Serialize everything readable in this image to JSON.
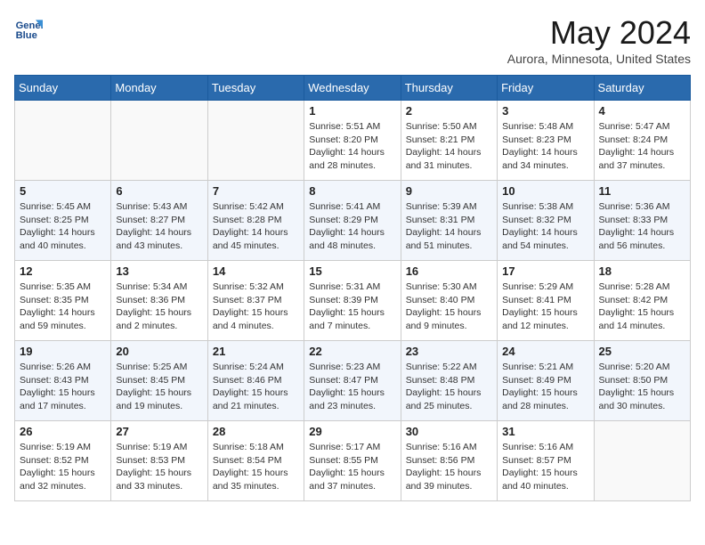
{
  "header": {
    "logo_line1": "General",
    "logo_line2": "Blue",
    "month_title": "May 2024",
    "location": "Aurora, Minnesota, United States"
  },
  "weekdays": [
    "Sunday",
    "Monday",
    "Tuesday",
    "Wednesday",
    "Thursday",
    "Friday",
    "Saturday"
  ],
  "weeks": [
    {
      "days": [
        {
          "num": "",
          "info": ""
        },
        {
          "num": "",
          "info": ""
        },
        {
          "num": "",
          "info": ""
        },
        {
          "num": "1",
          "info": "Sunrise: 5:51 AM\nSunset: 8:20 PM\nDaylight: 14 hours\nand 28 minutes."
        },
        {
          "num": "2",
          "info": "Sunrise: 5:50 AM\nSunset: 8:21 PM\nDaylight: 14 hours\nand 31 minutes."
        },
        {
          "num": "3",
          "info": "Sunrise: 5:48 AM\nSunset: 8:23 PM\nDaylight: 14 hours\nand 34 minutes."
        },
        {
          "num": "4",
          "info": "Sunrise: 5:47 AM\nSunset: 8:24 PM\nDaylight: 14 hours\nand 37 minutes."
        }
      ]
    },
    {
      "days": [
        {
          "num": "5",
          "info": "Sunrise: 5:45 AM\nSunset: 8:25 PM\nDaylight: 14 hours\nand 40 minutes."
        },
        {
          "num": "6",
          "info": "Sunrise: 5:43 AM\nSunset: 8:27 PM\nDaylight: 14 hours\nand 43 minutes."
        },
        {
          "num": "7",
          "info": "Sunrise: 5:42 AM\nSunset: 8:28 PM\nDaylight: 14 hours\nand 45 minutes."
        },
        {
          "num": "8",
          "info": "Sunrise: 5:41 AM\nSunset: 8:29 PM\nDaylight: 14 hours\nand 48 minutes."
        },
        {
          "num": "9",
          "info": "Sunrise: 5:39 AM\nSunset: 8:31 PM\nDaylight: 14 hours\nand 51 minutes."
        },
        {
          "num": "10",
          "info": "Sunrise: 5:38 AM\nSunset: 8:32 PM\nDaylight: 14 hours\nand 54 minutes."
        },
        {
          "num": "11",
          "info": "Sunrise: 5:36 AM\nSunset: 8:33 PM\nDaylight: 14 hours\nand 56 minutes."
        }
      ]
    },
    {
      "days": [
        {
          "num": "12",
          "info": "Sunrise: 5:35 AM\nSunset: 8:35 PM\nDaylight: 14 hours\nand 59 minutes."
        },
        {
          "num": "13",
          "info": "Sunrise: 5:34 AM\nSunset: 8:36 PM\nDaylight: 15 hours\nand 2 minutes."
        },
        {
          "num": "14",
          "info": "Sunrise: 5:32 AM\nSunset: 8:37 PM\nDaylight: 15 hours\nand 4 minutes."
        },
        {
          "num": "15",
          "info": "Sunrise: 5:31 AM\nSunset: 8:39 PM\nDaylight: 15 hours\nand 7 minutes."
        },
        {
          "num": "16",
          "info": "Sunrise: 5:30 AM\nSunset: 8:40 PM\nDaylight: 15 hours\nand 9 minutes."
        },
        {
          "num": "17",
          "info": "Sunrise: 5:29 AM\nSunset: 8:41 PM\nDaylight: 15 hours\nand 12 minutes."
        },
        {
          "num": "18",
          "info": "Sunrise: 5:28 AM\nSunset: 8:42 PM\nDaylight: 15 hours\nand 14 minutes."
        }
      ]
    },
    {
      "days": [
        {
          "num": "19",
          "info": "Sunrise: 5:26 AM\nSunset: 8:43 PM\nDaylight: 15 hours\nand 17 minutes."
        },
        {
          "num": "20",
          "info": "Sunrise: 5:25 AM\nSunset: 8:45 PM\nDaylight: 15 hours\nand 19 minutes."
        },
        {
          "num": "21",
          "info": "Sunrise: 5:24 AM\nSunset: 8:46 PM\nDaylight: 15 hours\nand 21 minutes."
        },
        {
          "num": "22",
          "info": "Sunrise: 5:23 AM\nSunset: 8:47 PM\nDaylight: 15 hours\nand 23 minutes."
        },
        {
          "num": "23",
          "info": "Sunrise: 5:22 AM\nSunset: 8:48 PM\nDaylight: 15 hours\nand 25 minutes."
        },
        {
          "num": "24",
          "info": "Sunrise: 5:21 AM\nSunset: 8:49 PM\nDaylight: 15 hours\nand 28 minutes."
        },
        {
          "num": "25",
          "info": "Sunrise: 5:20 AM\nSunset: 8:50 PM\nDaylight: 15 hours\nand 30 minutes."
        }
      ]
    },
    {
      "days": [
        {
          "num": "26",
          "info": "Sunrise: 5:19 AM\nSunset: 8:52 PM\nDaylight: 15 hours\nand 32 minutes."
        },
        {
          "num": "27",
          "info": "Sunrise: 5:19 AM\nSunset: 8:53 PM\nDaylight: 15 hours\nand 33 minutes."
        },
        {
          "num": "28",
          "info": "Sunrise: 5:18 AM\nSunset: 8:54 PM\nDaylight: 15 hours\nand 35 minutes."
        },
        {
          "num": "29",
          "info": "Sunrise: 5:17 AM\nSunset: 8:55 PM\nDaylight: 15 hours\nand 37 minutes."
        },
        {
          "num": "30",
          "info": "Sunrise: 5:16 AM\nSunset: 8:56 PM\nDaylight: 15 hours\nand 39 minutes."
        },
        {
          "num": "31",
          "info": "Sunrise: 5:16 AM\nSunset: 8:57 PM\nDaylight: 15 hours\nand 40 minutes."
        },
        {
          "num": "",
          "info": ""
        }
      ]
    }
  ]
}
